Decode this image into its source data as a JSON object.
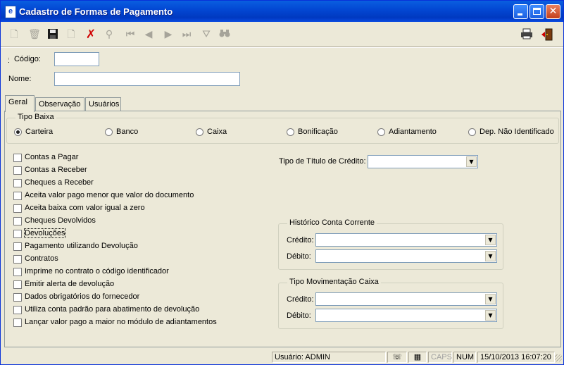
{
  "window": {
    "title": "Cadastro de Formas de Pagamento",
    "app_icon": "e"
  },
  "toolbar": {
    "icons": [
      "new-icon",
      "trash-icon",
      "save-icon",
      "blank-document-icon",
      "delete-icon",
      "search-icon",
      "first-icon",
      "previous-icon",
      "next-icon",
      "last-icon",
      "filter-icon",
      "binoculars-icon",
      "printer-icon",
      "exit-icon"
    ]
  },
  "form": {
    "codigo_label": "Código:",
    "codigo_value": "",
    "nome_label": "Nome:",
    "nome_value": ""
  },
  "tabs": [
    {
      "label": "Geral",
      "selected": true
    },
    {
      "label": "Observação",
      "selected": false
    },
    {
      "label": "Usuários",
      "selected": false
    }
  ],
  "tipo_baixa": {
    "title": "Tipo Baixa",
    "options": [
      {
        "label": "Carteira",
        "selected": true
      },
      {
        "label": "Banco",
        "selected": false
      },
      {
        "label": "Caixa",
        "selected": false
      },
      {
        "label": "Bonificação",
        "selected": false
      },
      {
        "label": "Adiantamento",
        "selected": false
      },
      {
        "label": "Dep. Não Identificado",
        "selected": false
      }
    ]
  },
  "checkboxes": [
    "Contas a Pagar",
    "Contas a Receber",
    "Cheques a Receber",
    "Aceita valor pago menor que valor do documento",
    "Aceita baixa com valor igual a zero",
    "Cheques Devolvidos",
    "Devoluções",
    "Pagamento utilizando Devolução",
    "Contratos",
    "Imprime no contrato o código identificador",
    "Emitir alerta de devolução",
    "Dados obrigatórios do fornecedor",
    "Utiliza conta padrão para abatimento de devolução",
    "Lançar valor pago a maior no módulo de adiantamentos"
  ],
  "tipo_titulo": {
    "label": "Tipo de Título de Crédito:",
    "value": ""
  },
  "historico": {
    "title": "Histórico Conta Corrente",
    "credito_label": "Crédito:",
    "credito_value": "",
    "debito_label": "Débito:",
    "debito_value": ""
  },
  "movimentacao": {
    "title": "Tipo Movimentação Caixa",
    "credito_label": "Crédito:",
    "credito_value": "",
    "debito_label": "Débito:",
    "debito_value": ""
  },
  "status": {
    "usuario": "Usuário: ADMIN",
    "caps": "CAPS",
    "num": "NUM",
    "datetime": "15/10/2013 16:07:20"
  }
}
